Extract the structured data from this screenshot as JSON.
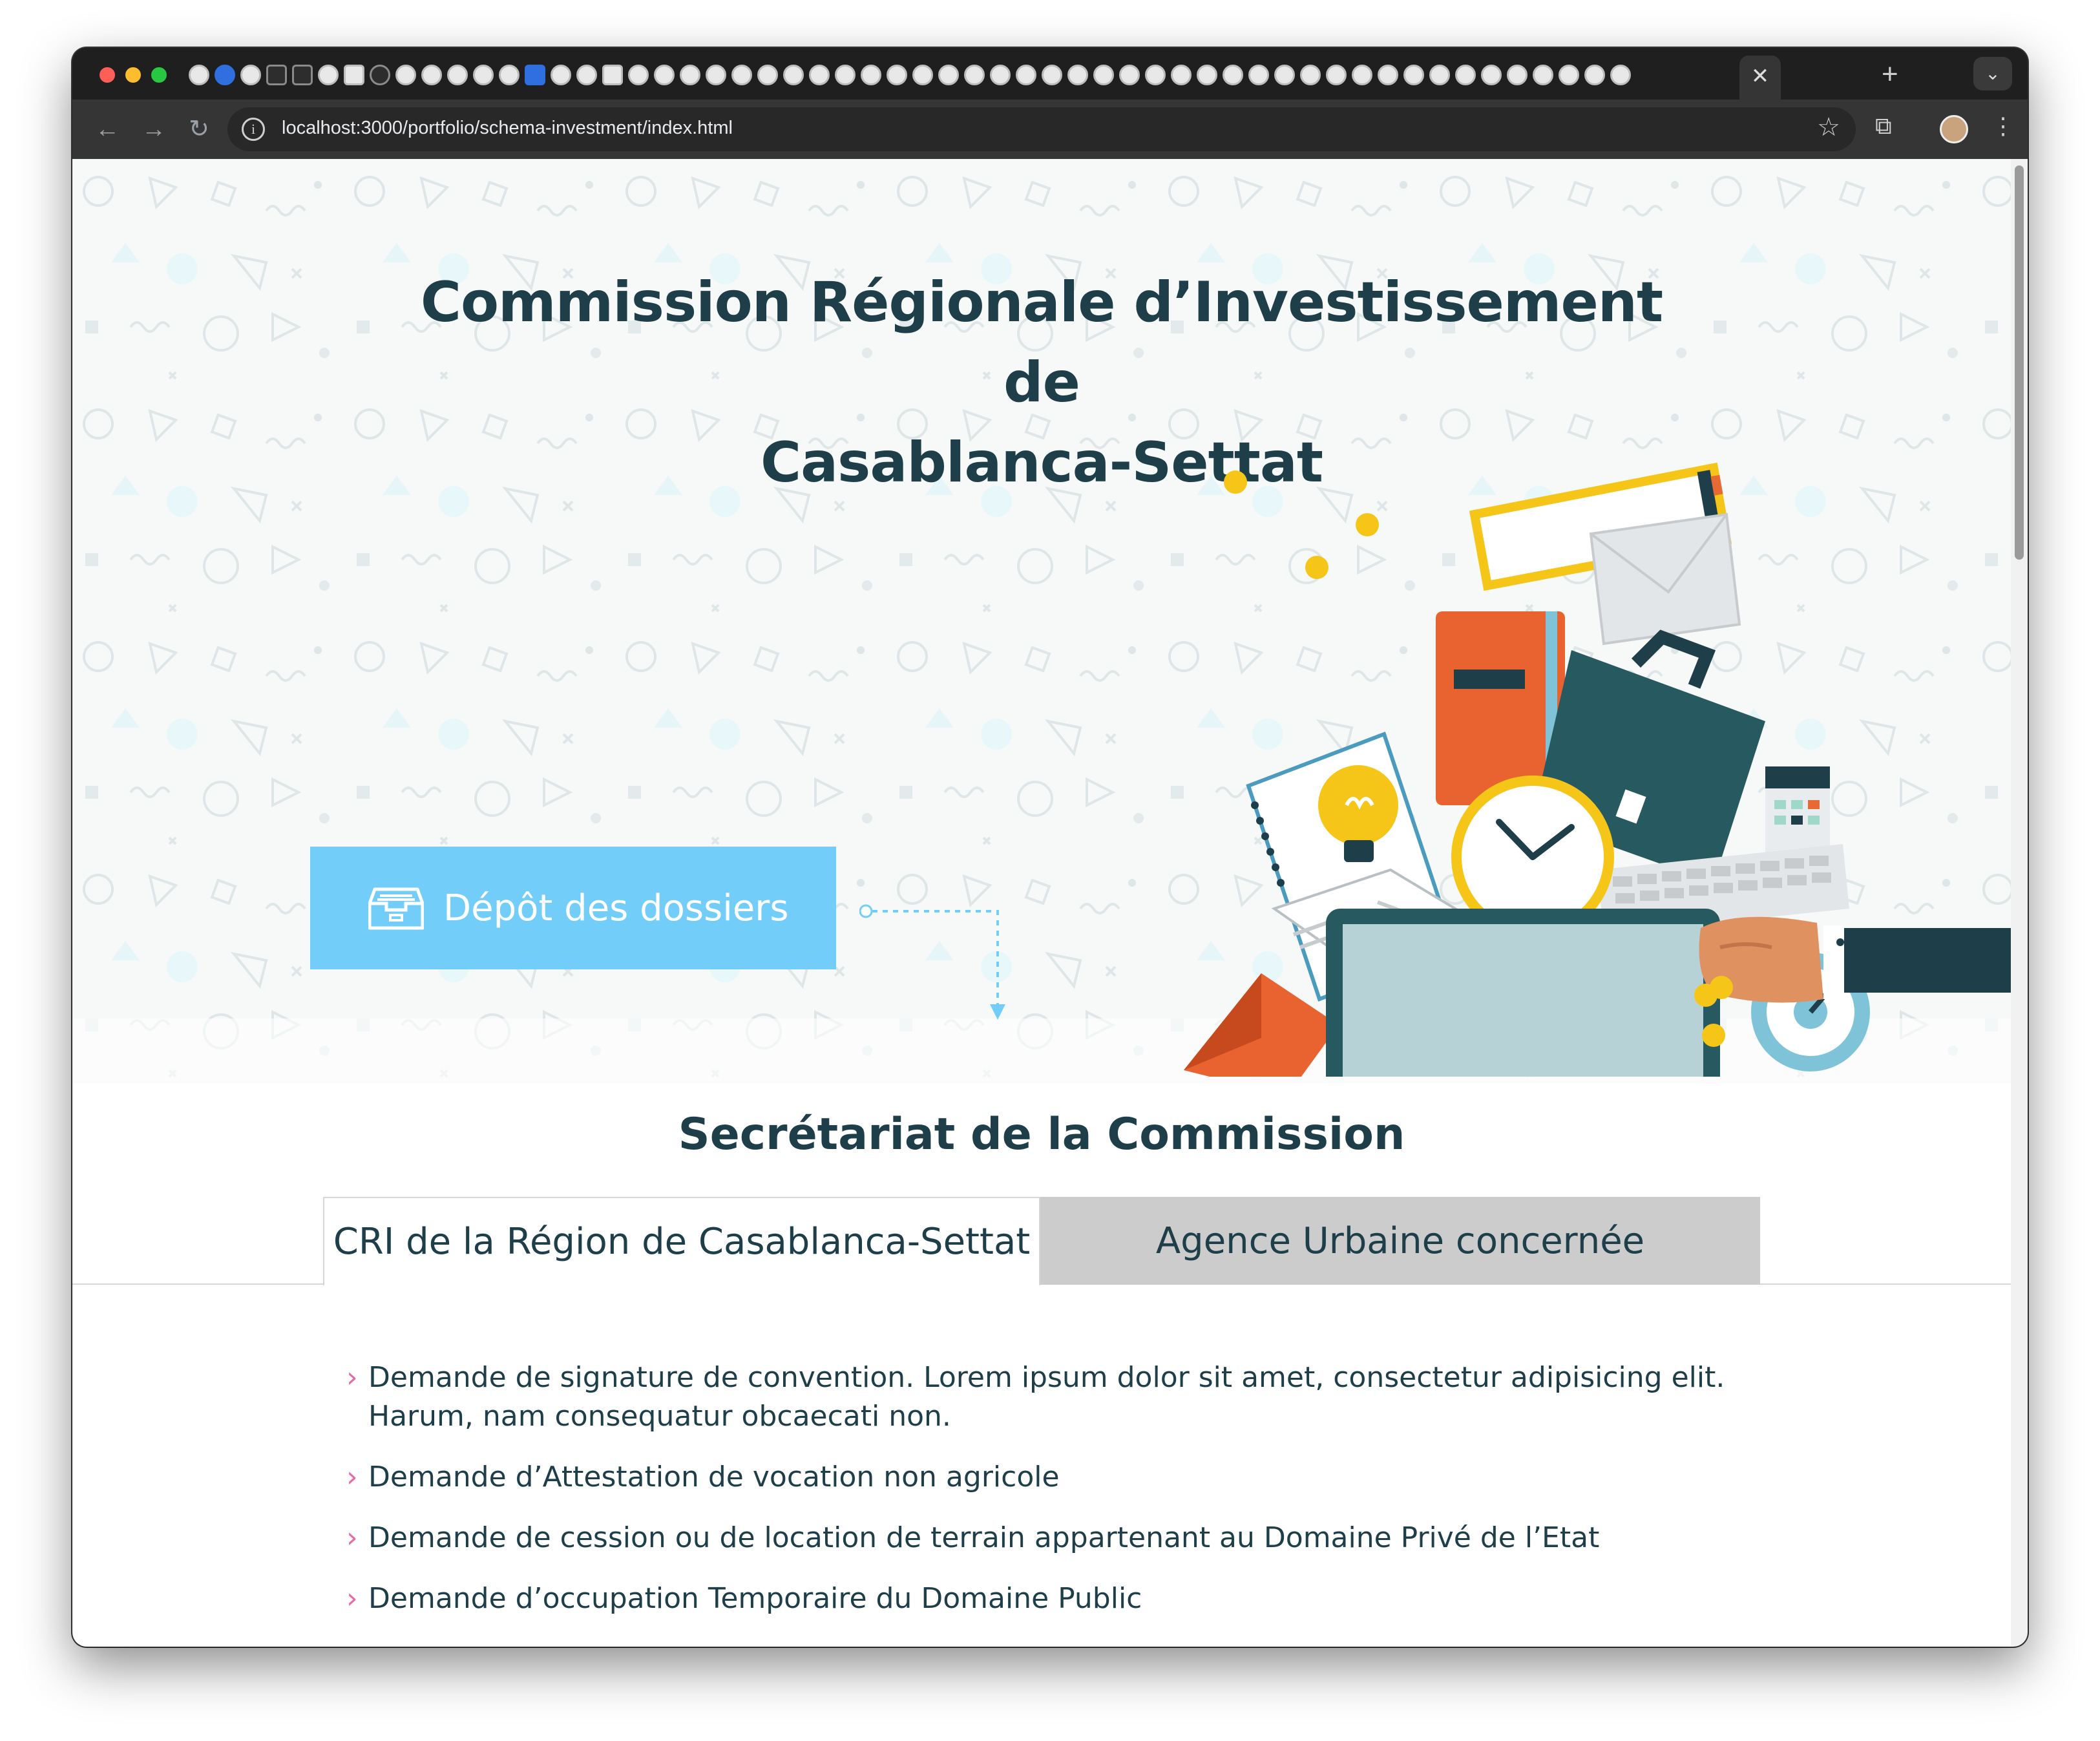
{
  "browser": {
    "url": "localhost:3000/portfolio/schema-investment/index.html",
    "active_tab_close": "✕",
    "new_tab": "+"
  },
  "hero": {
    "title_line1": "Commission Régionale d’Investissement de",
    "title_line2": "Casablanca-Settat",
    "depot_button": "Dépôt des dossiers"
  },
  "secretariat": {
    "title": "Secrétariat de la Commission",
    "tabs": [
      {
        "label": "CRI de la Région de Casablanca-Settat",
        "active": true
      },
      {
        "label": "Agence Urbaine concernée",
        "active": false
      }
    ],
    "items": [
      {
        "line1": "Demande de signature de convention. Lorem ipsum dolor sit amet, consectetur adipisicing elit.",
        "line2": "Harum, nam consequatur obcaecati non."
      },
      {
        "line1": "Demande d’Attestation de vocation non agricole"
      },
      {
        "line1": "Demande de cession ou de location de terrain appartenant au Domaine Privé de l’Etat"
      },
      {
        "line1": "Demande d’occupation Temporaire du Domaine Public"
      }
    ]
  },
  "colors": {
    "accent": "#72cdf8",
    "heading": "#1e3f4a",
    "bullet": "#e86aa6",
    "tab_inactive": "#cccccc"
  }
}
